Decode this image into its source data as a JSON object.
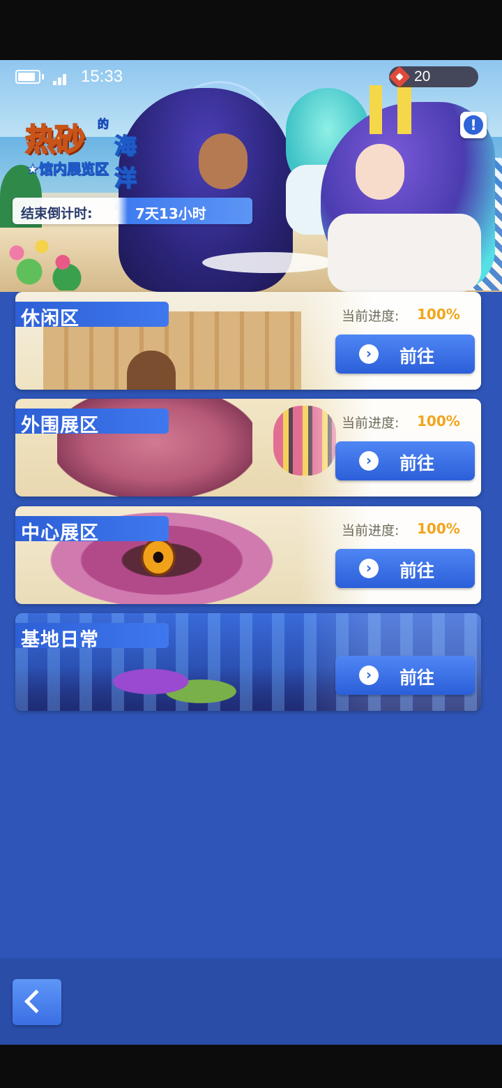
{
  "status_bar": {
    "time": "15:33",
    "ticket_count": "20"
  },
  "banner": {
    "title_main": "热砂",
    "title_de": "的",
    "title_sub": "海洋馆",
    "area_label": "★馆内展览区",
    "countdown_label": "结束倒计时:",
    "countdown_value": "7天13小时",
    "info_glyph": "!"
  },
  "zones": [
    {
      "name": "休闲区",
      "progress_label": "当前进度:",
      "progress_value": "100%",
      "go_label": "前往"
    },
    {
      "name": "外围展区",
      "progress_label": "当前进度:",
      "progress_value": "100%",
      "go_label": "前往"
    },
    {
      "name": "中心展区",
      "progress_label": "当前进度:",
      "progress_value": "100%",
      "go_label": "前往"
    },
    {
      "name": "基地日常",
      "go_label": "前往"
    }
  ],
  "icons": {
    "back": "chevron-left-icon",
    "go": "chevron-right-circle-icon",
    "info": "exclamation-icon",
    "ticket": "ticket-icon"
  },
  "colors": {
    "background": "#2e55b7",
    "button_blue": "#3b6fe3",
    "progress_value": "#f2a51a"
  }
}
